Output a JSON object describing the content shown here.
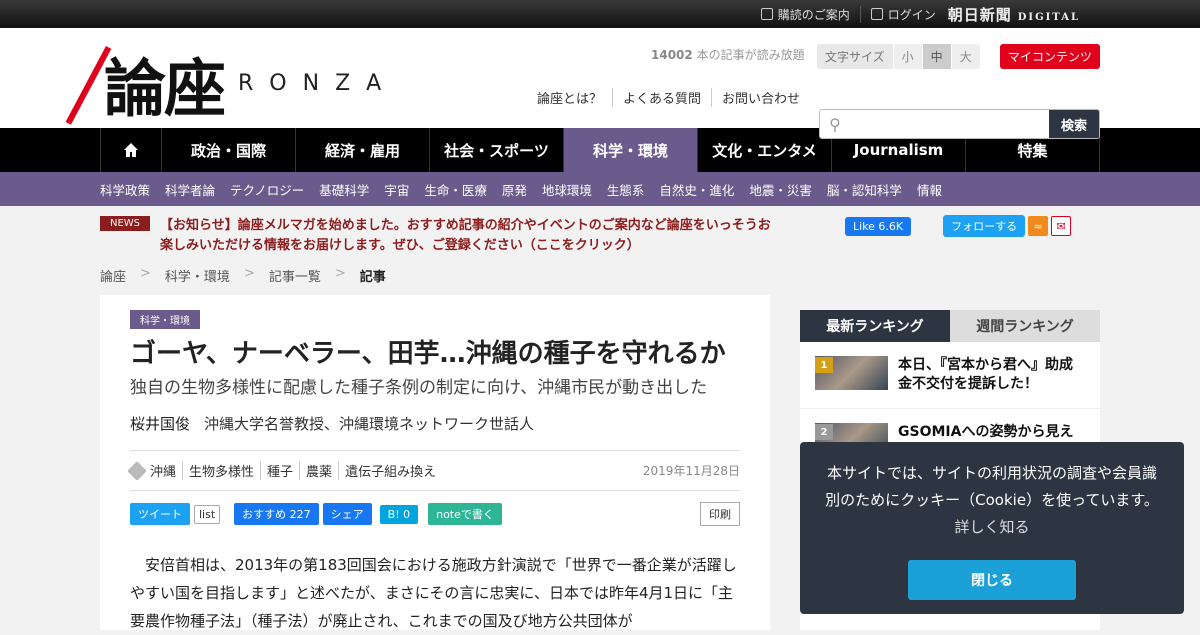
{
  "topbar": {
    "subscribe": "購読のご案内",
    "login": "ログイン",
    "brand": "朝日新聞",
    "brand_sub": "DIGITAL"
  },
  "header": {
    "logo_kanji": "論座",
    "logo_latin": "RONZA",
    "article_count": "14002",
    "article_count_suffix": " 本の記事が読み放題",
    "fontsize_label": "文字サイズ",
    "fontsize_options": [
      "小",
      "中",
      "大"
    ],
    "fontsize_selected": "中",
    "mycontents": "マイコンテンツ",
    "links": [
      "論座とは？",
      "よくある質問",
      "お問い合わせ"
    ],
    "search_placeholder": "",
    "search_button": "検索"
  },
  "nav": {
    "items": [
      "政治・国際",
      "経済・雇用",
      "社会・スポーツ",
      "科学・環境",
      "文化・エンタメ",
      "Journalism",
      "特集"
    ],
    "active": "科学・環境"
  },
  "subnav": {
    "items": [
      "科学政策",
      "科学者論",
      "テクノロジー",
      "基礎科学",
      "宇宙",
      "生命・医療",
      "原発",
      "地球環境",
      "生態系",
      "自然史・進化",
      "地震・災害",
      "脳・認知科学",
      "情報"
    ]
  },
  "news": {
    "badge": "NEWS",
    "text": "【お知らせ】論座メルマガを始めました。おすすめ記事の紹介やイベントのご案内など論座をいっそうお楽しみいただける情報をお届けします。ぜひ、ご登録ください（ここをクリック）"
  },
  "social_top": {
    "fb_like": "Like 6.6K",
    "tw_follow": "フォローする"
  },
  "breadcrumb": [
    "論座",
    "科学・環境",
    "記事一覧",
    "記事"
  ],
  "article": {
    "category": "科学・環境",
    "title": "ゴーヤ、ナーベラー、田芋…沖縄の種子を守れるか",
    "subtitle": "独自の生物多様性に配慮した種子条例の制定に向け、沖縄市民が動き出した",
    "author_name": "桜井国俊",
    "author_title": "沖縄大学名誉教授、沖縄環境ネットワーク世話人",
    "tags": [
      "沖縄",
      "生物多様性",
      "種子",
      "農薬",
      "遺伝子組み換え"
    ],
    "date": "2019年11月28日",
    "share": {
      "tweet": "ツイート",
      "list": "list",
      "fb_recommend": "おすすめ 227",
      "fb_share": "シェア",
      "hatena": "B! 0",
      "note": "noteで書く",
      "print": "印刷"
    },
    "body": "安倍首相は、2013年の第183回国会における施政方針演説で「世界で一番企業が活躍しやすい国を目指します」と述べたが、まさにその言に忠実に、日本では昨年4月1日に「主要農作物種子法」（種子法）が廃止され、これまでの国及び地方公共団体が"
  },
  "ranking": {
    "tabs": [
      "最新ランキング",
      "週間ランキング"
    ],
    "active_tab": "最新ランキング",
    "items": [
      {
        "rank": "1",
        "title": "本日、『宮本から君へ』助成金不交付を提訴した！",
        "color": "#d4a017"
      },
      {
        "rank": "2",
        "title": "GSOMIAへの姿勢から見え",
        "color": "#999999"
      }
    ]
  },
  "cookie": {
    "text": "本サイトでは、サイトの利用状況の調査や会員識別のためにクッキー（Cookie）を使っています。",
    "more": "詳しく知る",
    "close": "閉じる"
  }
}
